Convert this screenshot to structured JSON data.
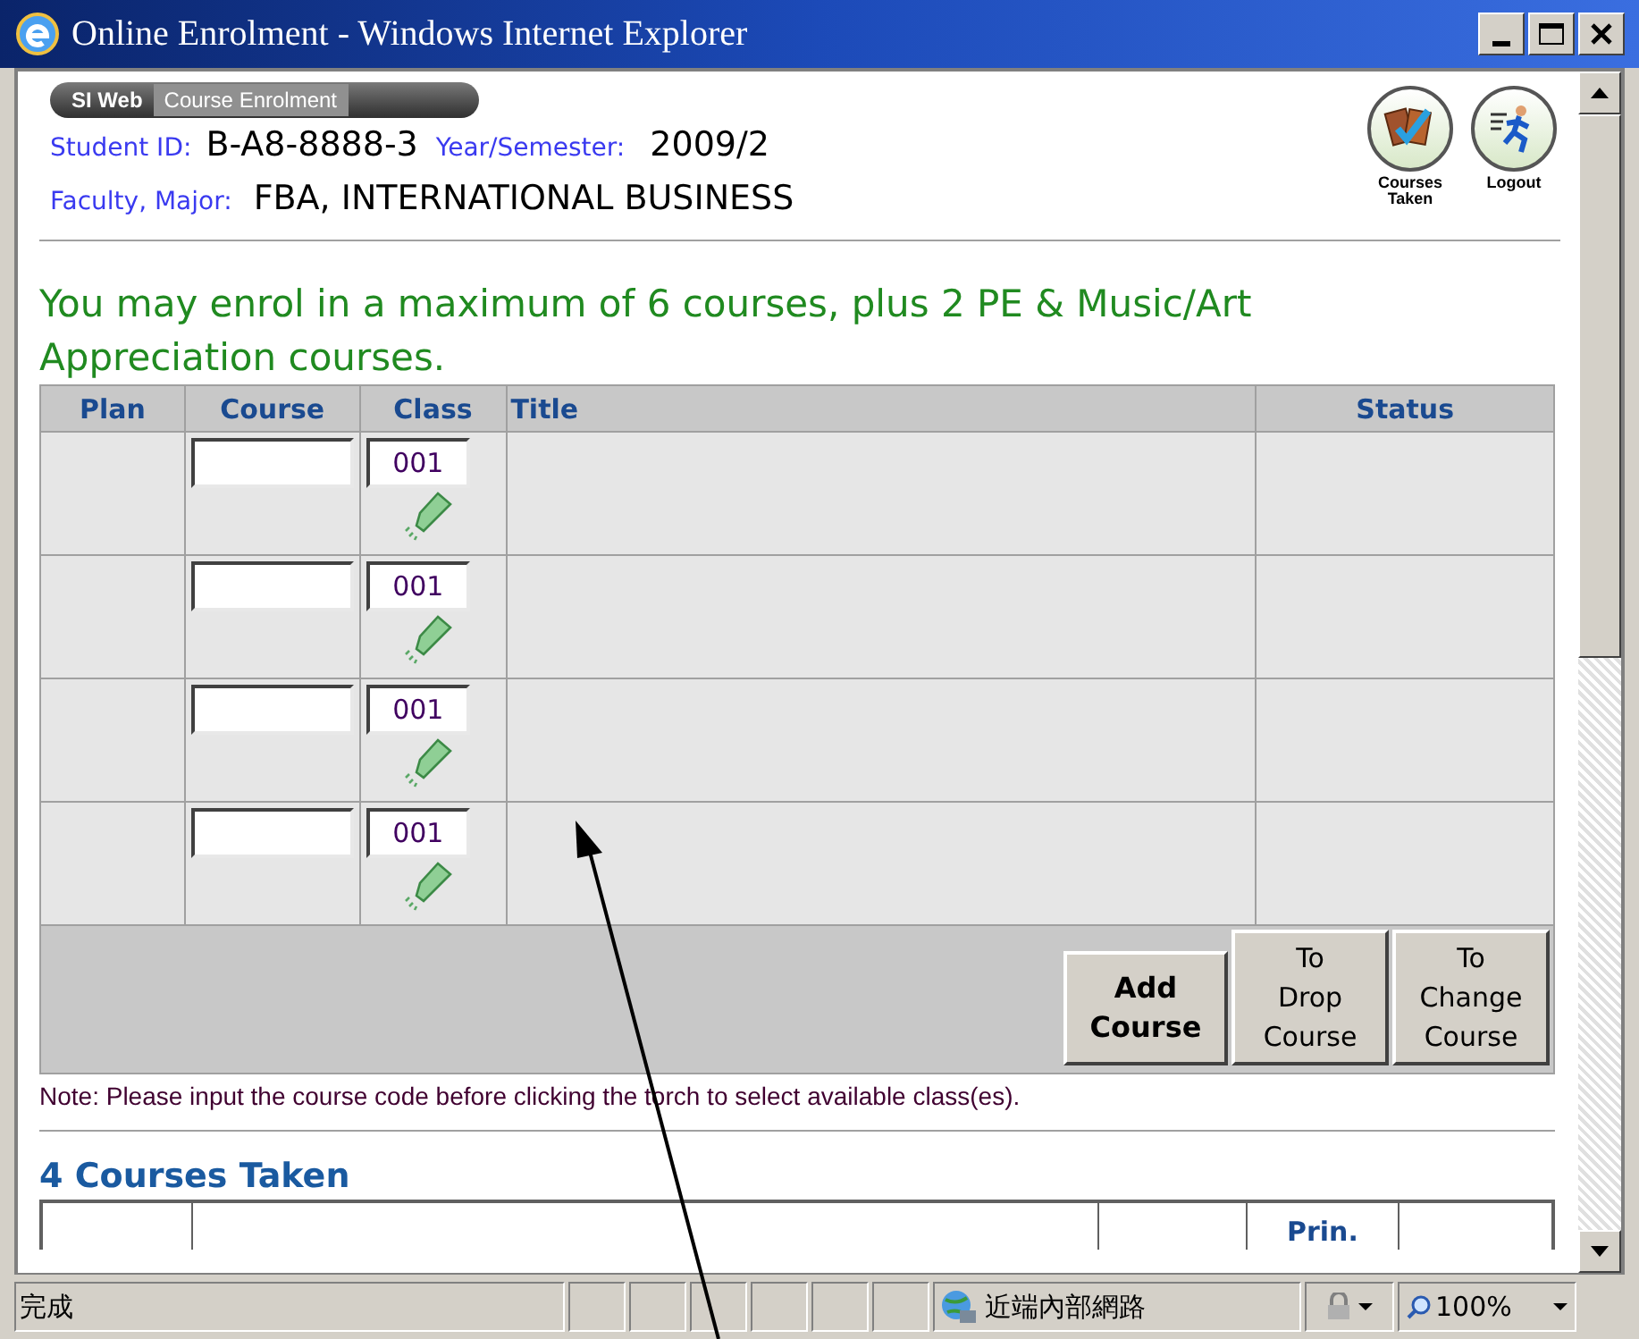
{
  "window": {
    "title": "Online Enrolment - Windows Internet Explorer"
  },
  "header": {
    "banner": [
      "SI Web",
      "Course Enrolment"
    ],
    "fields": [
      {
        "label": "Student ID:",
        "value": "B-A8-8888-3"
      },
      {
        "label": "Year/Semester:",
        "value": "2009/2"
      },
      {
        "label": "Faculty, Major:",
        "value": "FBA, INTERNATIONAL BUSINESS"
      }
    ],
    "shortcuts": [
      {
        "label": "Courses Taken",
        "kind": "cards"
      },
      {
        "label": "Logout",
        "kind": "runner"
      }
    ]
  },
  "notice": "You may enrol in a maximum of 6 courses, plus 2 PE & Music/Art Appreciation courses.",
  "table": {
    "columns": [
      "Plan",
      "Course",
      "Class",
      "Title",
      "Status"
    ],
    "rows": [
      {
        "class": "001"
      },
      {
        "class": "001"
      },
      {
        "class": "001"
      },
      {
        "class": "001"
      }
    ],
    "buttons": [
      {
        "label": "Add Course",
        "bold": true
      },
      {
        "label": "To Drop Course",
        "bold": false
      },
      {
        "label": "To Change Course",
        "bold": false
      }
    ]
  },
  "note": "Note: Please input the course code before clicking the torch to select available class(es).",
  "taken": {
    "heading": "4 Courses Taken",
    "columns": [
      "",
      "",
      "",
      "Prin.",
      ""
    ]
  },
  "status_bar": {
    "text": "完成",
    "zone": "近端內部網路",
    "zoom": "100%"
  }
}
